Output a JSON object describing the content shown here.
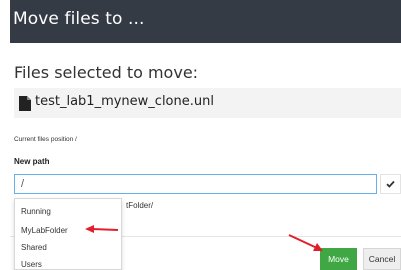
{
  "modal": {
    "title": "Move files to ..."
  },
  "selection": {
    "heading": "Files selected to move:",
    "file_name": "test_lab1_mynew_clone.unl",
    "file_icon": "file-icon"
  },
  "position": {
    "current_label": "Current files position /"
  },
  "new_path": {
    "label": "New path",
    "value": "/",
    "placeholder": "",
    "confirm_icon": "checkmark-icon",
    "behind_text": "tFolder/"
  },
  "dropdown": {
    "items": [
      "Running",
      "MyLabFolder",
      "Shared",
      "Users"
    ]
  },
  "footer": {
    "move_label": "Move",
    "cancel_label": "Cancel"
  },
  "colors": {
    "header_bg": "#353b45",
    "accent_green": "#3fa845",
    "annotation_red": "#e0202a",
    "input_focus": "#66afe9"
  }
}
